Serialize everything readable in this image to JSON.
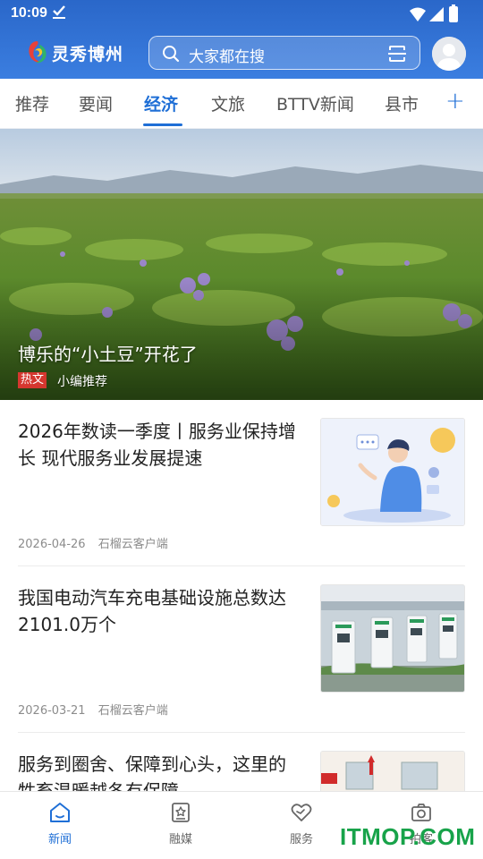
{
  "status_bar": {
    "time": "10:09"
  },
  "app": {
    "logo_text": "灵秀博州"
  },
  "search": {
    "placeholder": "大家都在搜"
  },
  "tabs": [
    {
      "label": "推荐",
      "active": false
    },
    {
      "label": "要闻",
      "active": false
    },
    {
      "label": "经济",
      "active": true
    },
    {
      "label": "文旅",
      "active": false
    },
    {
      "label": "BTTV新闻",
      "active": false
    },
    {
      "label": "县市",
      "active": false
    }
  ],
  "tab_add": "+",
  "hero": {
    "title": "博乐的“小土豆”开花了",
    "badge": "热文",
    "source": "小编推荐"
  },
  "news": [
    {
      "title": "2026年数读一季度丨服务业保持增长 现代服务业发展提速",
      "date": "2026-04-26",
      "source": "石榴云客户端",
      "thumb": "service-illustration"
    },
    {
      "title": "我国电动汽车充电基础设施总数达2101.0万个",
      "date": "2026-03-21",
      "source": "石榴云客户端",
      "thumb": "charging-stations-photo"
    },
    {
      "title": "服务到圈舍、保障到心头，这里的牲畜温暖越冬有保障",
      "date": "",
      "source": "",
      "thumb": "building-photo"
    }
  ],
  "bottom_nav": [
    {
      "label": "新闻",
      "icon": "home-icon",
      "active": true
    },
    {
      "label": "融媒",
      "icon": "media-icon",
      "active": false
    },
    {
      "label": "服务",
      "icon": "heart-icon",
      "active": false
    },
    {
      "label": "拍客",
      "icon": "camera-icon",
      "active": false
    }
  ],
  "watermark": "ITMOP.COM",
  "colors": {
    "brand_blue": "#1f6fd6",
    "header_blue": "#2a67c9",
    "hot_badge": "#d5372f",
    "watermark_green": "#18a34a"
  }
}
